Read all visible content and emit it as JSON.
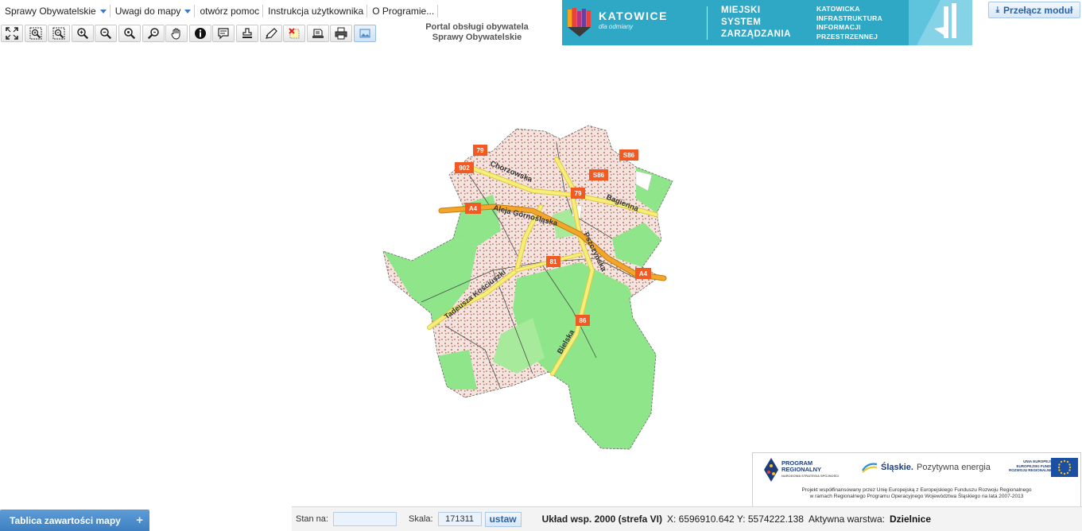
{
  "menu": {
    "items": [
      {
        "label": "Sprawy Obywatelskie",
        "dropdown": true
      },
      {
        "label": "Uwagi do mapy",
        "dropdown": true
      },
      {
        "label": "otwórz pomoc",
        "dropdown": false
      },
      {
        "label": "Instrukcja użytkownika",
        "dropdown": false
      },
      {
        "label": "O Programie...",
        "dropdown": false
      }
    ]
  },
  "toolbar": {
    "tools": [
      {
        "name": "full-extent-icon"
      },
      {
        "name": "zoom-window-icon"
      },
      {
        "name": "zoom-out-window-icon"
      },
      {
        "name": "zoom-in-icon"
      },
      {
        "name": "zoom-out-icon"
      },
      {
        "name": "zoom-previous-icon"
      },
      {
        "name": "zoom-next-icon"
      },
      {
        "name": "pan-hand-icon"
      },
      {
        "name": "info-icon"
      },
      {
        "name": "tooltip-icon"
      },
      {
        "name": "stamp-icon"
      },
      {
        "name": "measure-pencil-icon"
      },
      {
        "name": "clear-selection-icon"
      },
      {
        "name": "edit-print-icon"
      },
      {
        "name": "printer-icon"
      },
      {
        "name": "image-export-icon"
      }
    ]
  },
  "portal": {
    "line1": "Portal obsługi obywatela",
    "line2": "Sprawy Obywatelskie"
  },
  "banner": {
    "city": "KATOWICE",
    "city_sub": "dla odmiany",
    "system_line1": "MIEJSKI",
    "system_line2": "SYSTEM",
    "system_line3": "ZARZĄDZANIA",
    "kiip_line1": "KATOWICKA",
    "kiip_line2": "INFRASTRUKTURA",
    "kiip_line3": "INFORMACJI",
    "kiip_line4": "PRZESTRZENNEJ"
  },
  "switch_module": {
    "label": "Przełącz moduł"
  },
  "map": {
    "road_labels": [
      "Chorzowska",
      "Aleja Górnośląska",
      "Bagienna",
      "Pszczyńska",
      "Tadeusza Kościuszki",
      "Bielska"
    ],
    "shields": [
      "79",
      "902",
      "S86",
      "S86",
      "79",
      "A4",
      "A4",
      "81",
      "86"
    ]
  },
  "sponsor": {
    "program_line1": "PROGRAM",
    "program_line2": "REGIONALNY",
    "program_sub": "NARODOWA STRATEGIA SPÓJNOŚCI",
    "slaskie": "Śląskie.",
    "slaskie_slogan": "Pozytywna energia",
    "ue_line1": "UNIA EUROPEJSKA",
    "ue_line2": "EUROPEJSKI FUNDUSZ",
    "ue_line3": "ROZWOJU REGIONALNEGO",
    "note_line1": "Projekt współfinansowany przez Unię Europejską z Europejskiego Funduszu Rozwoju Regionalnego",
    "note_line2": "w ramach Regionalnego Programu Operacyjnego Województwa Śląskiego na lata 2007-2013"
  },
  "legend_tab": {
    "label": "Tablica zawartości mapy",
    "toggle": "+"
  },
  "status": {
    "stan_label": "Stan na:",
    "stan_value": "",
    "skala_label": "Skala:",
    "skala_value": "171311",
    "ustaw_label": "ustaw",
    "uklad": "Układ wsp. 2000 (strefa VI)",
    "coords": "X: 6596910.642 Y: 5574222.138",
    "aktywna_label": "Aktywna warstwa:",
    "aktywna_value": "Dzielnice"
  },
  "colors": {
    "accent": "#3f80c2",
    "banner": "#2fa8c6",
    "forest": "#8ee58a",
    "urban": "#d9a89a",
    "road_major": "#f2a72a",
    "road_minor": "#f6ee7a",
    "shield": "#f15a22"
  }
}
